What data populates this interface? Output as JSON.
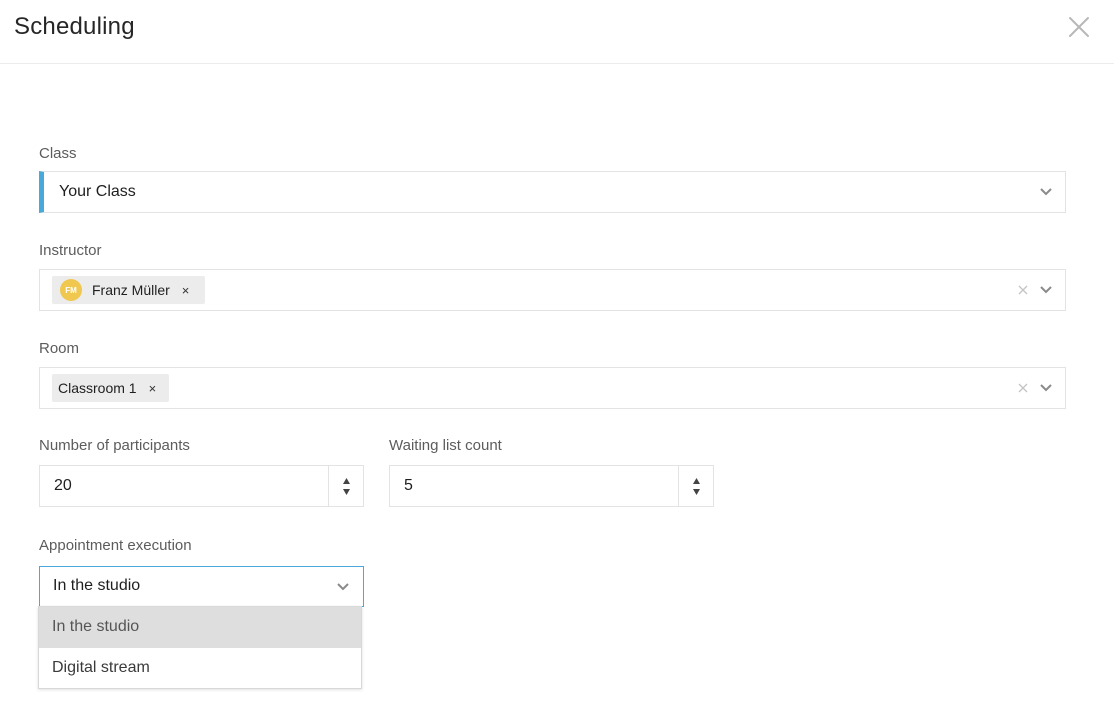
{
  "header": {
    "title": "Scheduling",
    "close_icon": "close-icon"
  },
  "form": {
    "class": {
      "label": "Class",
      "value": "Your Class",
      "accent_color": "#4aa9db"
    },
    "instructor": {
      "label": "Instructor",
      "chips": [
        {
          "initials": "FM",
          "name": "Franz Müller",
          "remove": "×",
          "avatar_color": "#f0c74f"
        }
      ]
    },
    "room": {
      "label": "Room",
      "chips": [
        {
          "name": "Classroom 1",
          "remove": "×"
        }
      ]
    },
    "participants": {
      "label": "Number of participants",
      "value": "20"
    },
    "waiting_list": {
      "label": "Waiting list count",
      "value": "5"
    },
    "appointment_execution": {
      "label": "Appointment execution",
      "value": "In the studio",
      "options": [
        "In the studio",
        "Digital stream"
      ],
      "highlighted_option": "In the studio"
    }
  }
}
